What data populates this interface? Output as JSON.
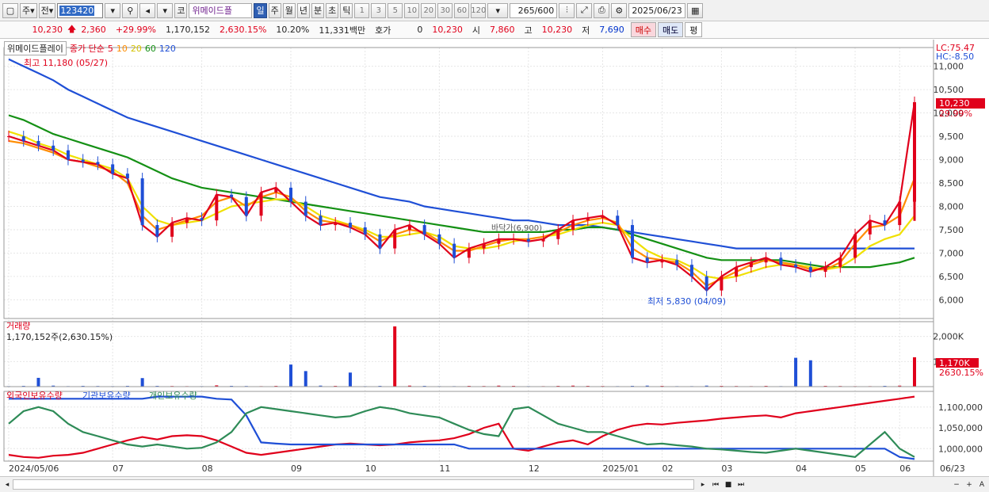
{
  "toolbar": {
    "mode1": "주",
    "mode2": "전",
    "code": "123420",
    "name": "위메이드플",
    "cb": "코",
    "periods": [
      "일",
      "주",
      "월",
      "년",
      "분",
      "초",
      "틱"
    ],
    "active_period": "일",
    "nums": [
      "1",
      "3",
      "5",
      "10",
      "20",
      "30",
      "60",
      "120"
    ],
    "count": "265/600",
    "date": "2025/06/23"
  },
  "quote": {
    "price": "10,230",
    "change": "2,360",
    "change_pct": "+29.99%",
    "volume": "1,170,152",
    "vol_ratio": "2,630.15%",
    "turnover": "10.20%",
    "amount": "11,331백만",
    "hoga_label": "호가",
    "hoga_value": "0",
    "hoga_price": "10,230",
    "open_label": "시",
    "open": "7,860",
    "high_label": "고",
    "high": "10,230",
    "low_label": "저",
    "low": "7,690",
    "buy": "매수",
    "sell": "매도",
    "avg": "평"
  },
  "legend": {
    "name": "위메이드플레이",
    "ma_label": "종가 단순",
    "ma": [
      "5",
      "10",
      "20",
      "60",
      "120"
    ],
    "ma_colors": [
      "#e0001b",
      "#ff8c00",
      "#f0e000",
      "#149014",
      "#1f4fd6"
    ]
  },
  "annotations": {
    "high": "최고 11,180 (05/27)",
    "low": "최저 5,830 (04/09)",
    "crosshair": "바닥가(6,900)",
    "lc": "LC:75.47",
    "hc": "HC:-8.50",
    "cur_price": "10,230",
    "cur_pct": "29.99%"
  },
  "volume_panel": {
    "title": "거래량",
    "value": "1,170,152주(2,630.15%)",
    "last_label": "1,170K",
    "last_pct": "2630.15%"
  },
  "holding_panel": {
    "legend": [
      "외국인보유수량",
      "기관보유수량",
      "개인보유수량"
    ],
    "colors": [
      "#e0001b",
      "#1f4fd6",
      "#2e8b57"
    ]
  },
  "chart_data": [
    {
      "type": "candlestick",
      "title": "위메이드플레이",
      "ylim": [
        5600,
        11400
      ],
      "y_ticks": [
        "6,000",
        "6,500",
        "7,000",
        "7,500",
        "8,000",
        "8,500",
        "9,000",
        "9,500",
        "10,000",
        "10,500",
        "11,000"
      ],
      "x_ticks": [
        "2024/05/06",
        "07",
        "08",
        "09",
        "10",
        "11",
        "12",
        "2025/01",
        "02",
        "03",
        "04",
        "05",
        "06",
        "06/23"
      ],
      "series": [
        {
          "name": "5",
          "values": [
            9500,
            9400,
            9300,
            9200,
            9000,
            8950,
            8900,
            8700,
            8600,
            7600,
            7350,
            7650,
            7750,
            7700,
            8250,
            8200,
            7800,
            8300,
            8400,
            8100,
            7800,
            7600,
            7650,
            7550,
            7400,
            7100,
            7500,
            7600,
            7400,
            7200,
            6900,
            7100,
            7200,
            7300,
            7300,
            7250,
            7300,
            7500,
            7700,
            7750,
            7800,
            7600,
            6900,
            6800,
            6850,
            6750,
            6500,
            6200,
            6500,
            6700,
            6800,
            6900,
            6750,
            6700,
            6600,
            6700,
            6900,
            7400,
            7700,
            7600,
            8100,
            10230
          ]
        },
        {
          "name": "10",
          "values": [
            9400,
            9350,
            9250,
            9150,
            9000,
            8950,
            8850,
            8750,
            8500,
            7800,
            7500,
            7600,
            7700,
            7800,
            8100,
            8200,
            8000,
            8200,
            8300,
            8200,
            7900,
            7700,
            7650,
            7600,
            7450,
            7250,
            7400,
            7500,
            7450,
            7250,
            7050,
            7050,
            7150,
            7250,
            7300,
            7300,
            7350,
            7450,
            7600,
            7700,
            7750,
            7650,
            7100,
            6900,
            6850,
            6800,
            6600,
            6300,
            6450,
            6600,
            6750,
            6850,
            6800,
            6750,
            6650,
            6650,
            6800,
            7200,
            7550,
            7600,
            7800,
            8600
          ]
        },
        {
          "name": "20",
          "values": [
            9600,
            9500,
            9350,
            9250,
            9100,
            9000,
            8900,
            8800,
            8600,
            8000,
            7700,
            7600,
            7650,
            7700,
            7850,
            8000,
            8050,
            8100,
            8150,
            8150,
            8000,
            7800,
            7700,
            7600,
            7500,
            7350,
            7350,
            7400,
            7450,
            7350,
            7150,
            7100,
            7100,
            7150,
            7250,
            7300,
            7350,
            7400,
            7500,
            7600,
            7650,
            7600,
            7300,
            7050,
            6900,
            6850,
            6700,
            6500,
            6450,
            6500,
            6600,
            6700,
            6750,
            6750,
            6700,
            6650,
            6700,
            6900,
            7150,
            7300,
            7400,
            7800
          ]
        },
        {
          "name": "60",
          "values": [
            9950,
            9850,
            9700,
            9550,
            9450,
            9350,
            9250,
            9150,
            9050,
            8900,
            8750,
            8600,
            8500,
            8400,
            8350,
            8300,
            8250,
            8200,
            8150,
            8100,
            8050,
            8000,
            7950,
            7900,
            7850,
            7800,
            7750,
            7700,
            7650,
            7600,
            7550,
            7500,
            7450,
            7450,
            7450,
            7450,
            7450,
            7500,
            7500,
            7550,
            7550,
            7500,
            7400,
            7300,
            7200,
            7100,
            7000,
            6900,
            6850,
            6850,
            6850,
            6850,
            6850,
            6800,
            6750,
            6700,
            6700,
            6700,
            6700,
            6750,
            6800,
            6900
          ]
        },
        {
          "name": "120",
          "values": [
            11150,
            11000,
            10850,
            10700,
            10500,
            10350,
            10200,
            10050,
            9900,
            9800,
            9700,
            9600,
            9500,
            9400,
            9300,
            9200,
            9100,
            9000,
            8900,
            8800,
            8700,
            8600,
            8500,
            8400,
            8300,
            8200,
            8150,
            8100,
            8000,
            7950,
            7900,
            7850,
            7800,
            7750,
            7700,
            7700,
            7650,
            7600,
            7600,
            7600,
            7550,
            7500,
            7450,
            7400,
            7350,
            7300,
            7250,
            7200,
            7150,
            7100,
            7100,
            7100,
            7100,
            7100,
            7100,
            7100,
            7100,
            7100,
            7100,
            7100,
            7100,
            7100
          ]
        }
      ]
    },
    {
      "type": "bar",
      "title": "거래량",
      "y_ticks": [
        "1,000K",
        "2,000K"
      ],
      "ylim": [
        0,
        2400000
      ],
      "values": [
        20000,
        30000,
        350000,
        40000,
        20000,
        30000,
        25000,
        20000,
        30000,
        340000,
        30000,
        25000,
        20000,
        20000,
        50000,
        30000,
        25000,
        20000,
        30000,
        880000,
        620000,
        40000,
        30000,
        560000,
        20000,
        30000,
        2400000,
        40000,
        30000,
        20000,
        20000,
        30000,
        25000,
        40000,
        30000,
        20000,
        20000,
        30000,
        40000,
        30000,
        25000,
        20000,
        30000,
        40000,
        30000,
        20000,
        20000,
        40000,
        30000,
        25000,
        20000,
        30000,
        20000,
        1150000,
        1050000,
        30000,
        25000,
        20000,
        20000,
        30000,
        40000,
        1170152
      ]
    },
    {
      "type": "line",
      "title": "외국인보유수량",
      "y_ticks": [
        "1,000,000",
        "1,050,000",
        "1,100,000"
      ],
      "ylim": [
        970000,
        1130000
      ],
      "series": [
        {
          "name": "외국인보유수량",
          "values": [
            985000,
            980000,
            978000,
            983000,
            985000,
            990000,
            1000000,
            1010000,
            1020000,
            1028000,
            1022000,
            1030000,
            1032000,
            1030000,
            1020000,
            1005000,
            990000,
            985000,
            990000,
            995000,
            1000000,
            1005000,
            1010000,
            1012000,
            1010000,
            1008000,
            1010000,
            1015000,
            1018000,
            1020000,
            1025000,
            1035000,
            1050000,
            1060000,
            1000000,
            995000,
            1005000,
            1015000,
            1020000,
            1010000,
            1030000,
            1045000,
            1055000,
            1060000,
            1058000,
            1062000,
            1065000,
            1068000,
            1072000,
            1075000,
            1078000,
            1080000,
            1075000,
            1085000,
            1090000,
            1095000,
            1100000,
            1105000,
            1110000,
            1115000,
            1120000,
            1125000
          ]
        },
        {
          "name": "기관보유수량",
          "values": [
            1120000,
            1120000,
            1120000,
            1120000,
            1120000,
            1120000,
            1120000,
            1120000,
            1120000,
            1120000,
            1125000,
            1125000,
            1125000,
            1125000,
            1120000,
            1118000,
            1080000,
            1015000,
            1012000,
            1010000,
            1010000,
            1010000,
            1010000,
            1010000,
            1010000,
            1010000,
            1010000,
            1010000,
            1010000,
            1010000,
            1010000,
            1000000,
            1000000,
            1000000,
            1000000,
            1000000,
            1000000,
            1000000,
            1000000,
            1000000,
            1000000,
            1000000,
            1000000,
            1000000,
            1000000,
            1000000,
            1000000,
            1000000,
            1000000,
            1000000,
            1000000,
            1000000,
            1000000,
            1000000,
            1000000,
            1000000,
            1000000,
            1000000,
            1000000,
            1000000,
            980000,
            975000
          ]
        },
        {
          "name": "개인보유수량",
          "values": [
            1060000,
            1090000,
            1100000,
            1090000,
            1060000,
            1040000,
            1030000,
            1020000,
            1010000,
            1005000,
            1010000,
            1005000,
            1000000,
            1002000,
            1015000,
            1040000,
            1085000,
            1100000,
            1095000,
            1090000,
            1085000,
            1080000,
            1075000,
            1078000,
            1090000,
            1100000,
            1095000,
            1085000,
            1080000,
            1075000,
            1060000,
            1045000,
            1035000,
            1030000,
            1095000,
            1100000,
            1080000,
            1060000,
            1050000,
            1040000,
            1040000,
            1030000,
            1020000,
            1010000,
            1012000,
            1008000,
            1005000,
            1000000,
            998000,
            995000,
            992000,
            990000,
            995000,
            1000000,
            995000,
            990000,
            985000,
            980000,
            1010000,
            1040000,
            1000000,
            980000
          ]
        }
      ]
    }
  ]
}
